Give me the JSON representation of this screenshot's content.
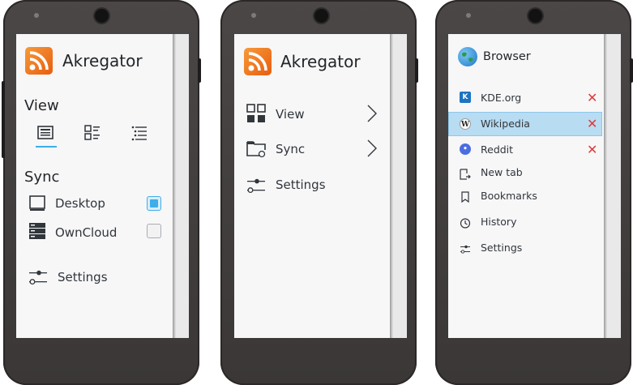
{
  "screen1": {
    "app_title": "Akregator",
    "view_heading": "View",
    "view_modes": [
      {
        "icon": "list-view-icon",
        "selected": true
      },
      {
        "icon": "grid-view-icon",
        "selected": false
      },
      {
        "icon": "detail-view-icon",
        "selected": false
      }
    ],
    "sync_heading": "Sync",
    "sync_items": [
      {
        "label": "Desktop",
        "icon": "desktop-icon",
        "checked": true
      },
      {
        "label": "OwnCloud",
        "icon": "server-icon",
        "checked": false
      }
    ],
    "settings_label": "Settings"
  },
  "screen2": {
    "app_title": "Akregator",
    "menu": [
      {
        "label": "View",
        "icon": "view-grid-icon",
        "has_submenu": true
      },
      {
        "label": "Sync",
        "icon": "folder-sync-icon",
        "has_submenu": true
      },
      {
        "label": "Settings",
        "icon": "settings-sliders-icon",
        "has_submenu": false
      }
    ]
  },
  "screen3": {
    "app_title": "Browser",
    "tabs": [
      {
        "label": "KDE.org",
        "icon": "kde-icon",
        "selected": false,
        "closable": true
      },
      {
        "label": "Wikipedia",
        "icon": "wikipedia-icon",
        "selected": true,
        "closable": true
      },
      {
        "label": "Reddit",
        "icon": "reddit-icon",
        "selected": false,
        "closable": true
      }
    ],
    "actions": [
      {
        "label": "New tab",
        "icon": "new-tab-icon"
      },
      {
        "label": "Bookmarks",
        "icon": "bookmark-icon"
      },
      {
        "label": "History",
        "icon": "history-icon"
      },
      {
        "label": "Settings",
        "icon": "settings-sliders-icon"
      }
    ]
  },
  "colors": {
    "accent": "#3daee9",
    "selection_bg": "#b8dcf2",
    "close_red": "#e03a3a",
    "rss_orange": "#f47a20",
    "phone_body": "#3f3c3b"
  }
}
